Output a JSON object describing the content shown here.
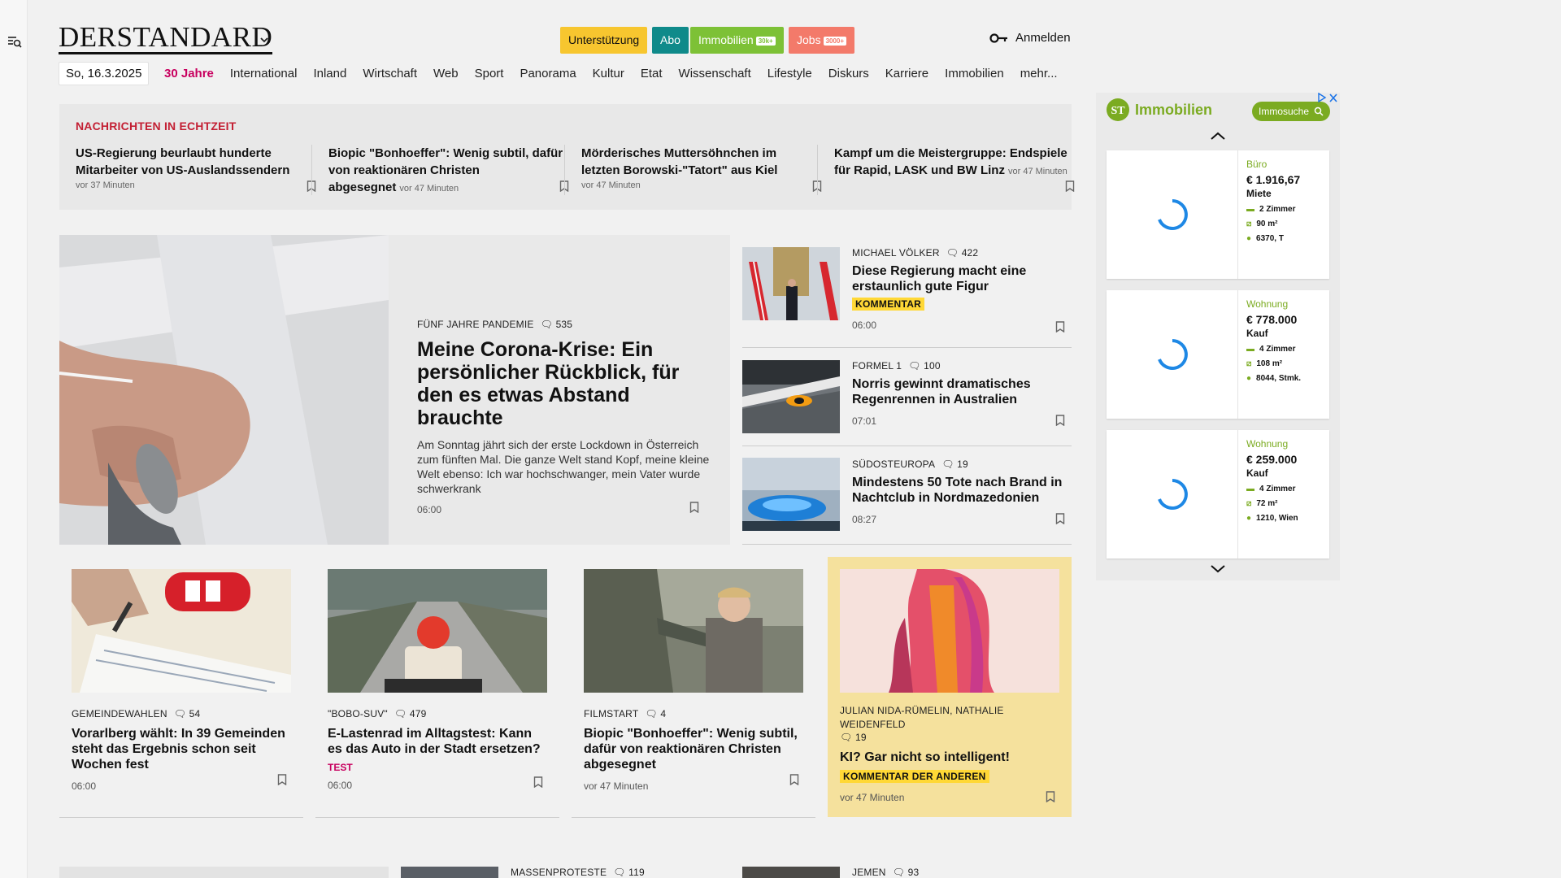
{
  "header": {
    "logo": "DERSTANDARD",
    "pills": {
      "unterstuetzung": "Unterstützung",
      "abo": "Abo",
      "immobilien": "Immobilien",
      "immobilien_tag": "30k+",
      "jobs": "Jobs",
      "jobs_tag": "3000+"
    },
    "login": "Anmelden",
    "date": "So, 16.3.2025"
  },
  "nav": [
    "30 Jahre",
    "International",
    "Inland",
    "Wirtschaft",
    "Web",
    "Sport",
    "Panorama",
    "Kultur",
    "Etat",
    "Wissenschaft",
    "Lifestyle",
    "Diskurs",
    "Karriere",
    "Immobilien",
    "mehr..."
  ],
  "ticker": {
    "heading": "NACHRICHTEN IN ECHTZEIT",
    "items": [
      {
        "title": "US-Regierung beurlaubt hunderte Mitarbeiter von US-Auslandssendern",
        "ago": "vor 37 Minuten"
      },
      {
        "title": "Biopic \"Bonhoeffer\": Wenig subtil, dafür von reaktionären Christen abgesegnet",
        "ago": "vor 47 Minuten"
      },
      {
        "title": "Mörderisches Muttersöhnchen im letzten Borowski-\"Tatort\" aus Kiel",
        "ago": "vor 47 Minuten"
      },
      {
        "title": "Kampf um die Meistergruppe: Endspiele für Rapid, LASK und BW Linz",
        "ago": "vor 47 Minuten"
      }
    ]
  },
  "lead": {
    "kicker": "FÜNF JAHRE PANDEMIE",
    "comments": "535",
    "title": "Meine Corona-Krise: Ein persönlicher Rückblick, für den es etwas Abstand brauchte",
    "teaser": "Am Sonntag jährt sich der erste Lockdown in Österreich zum fünften Mal. Die ganze Welt stand Kopf, meine kleine Welt ebenso: Ich war hochschwanger, mein Vater wurde schwerkrank",
    "time": "06:00"
  },
  "right_stories": [
    {
      "kicker": "MICHAEL VÖLKER",
      "comments": "422",
      "title": "Diese Regierung macht eine erstaunlich gute Figur",
      "badge": "KOMMENTAR",
      "time": "06:00"
    },
    {
      "kicker": "FORMEL 1",
      "comments": "100",
      "title": "Norris gewinnt dramatisches Regenrennen in Australien",
      "time": "07:01"
    },
    {
      "kicker": "SÜDOSTEUROPA",
      "comments": "19",
      "title": "Mindestens 50 Tote nach Brand in Nachtclub in Nordmazedonien",
      "time": "08:27"
    }
  ],
  "cards": [
    {
      "kicker": "GEMEINDEWAHLEN",
      "comments": "54",
      "title": "Vorarlberg wählt: In 39 Gemeinden steht das Ergebnis schon seit Wochen fest",
      "time": "06:00"
    },
    {
      "kicker": "\"BOBO-SUV\"",
      "comments": "479",
      "title": "E-Lastenrad im Alltagstest: Kann es das Auto in der Stadt ersetzen?",
      "label": "TEST",
      "time": "06:00"
    },
    {
      "kicker": "FILMSTART",
      "comments": "4",
      "title": "Biopic \"Bonhoeffer\": Wenig subtil, dafür von reaktionären Christen abgesegnet",
      "time": "vor 47 Minuten"
    },
    {
      "kicker": "JULIAN NIDA-RÜMELIN, NATHALIE WEIDENFELD",
      "comments": "19",
      "title": "KI? Gar nicht so intelligent!",
      "badge": "KOMMENTAR DER ANDEREN",
      "time": "vor 47 Minuten"
    }
  ],
  "bottom": [
    {
      "kicker": "MASSENPROTESTE",
      "comments": "119"
    },
    {
      "kicker": "JEMEN",
      "comments": "93"
    }
  ],
  "ad": {
    "brand": "Immobilien",
    "search_button": "Immosuche",
    "listings": [
      {
        "category": "Büro",
        "price": "€ 1.916,67",
        "kind": "Miete",
        "rooms": "2 Zimmer",
        "area": "90 m²",
        "location": "6370, T"
      },
      {
        "category": "Wohnung",
        "price": "€ 778.000",
        "kind": "Kauf",
        "rooms": "4 Zimmer",
        "area": "108 m²",
        "location": "8044, Stmk."
      },
      {
        "category": "Wohnung",
        "price": "€ 259.000",
        "kind": "Kauf",
        "rooms": "4 Zimmer",
        "area": "72 m²",
        "location": "1210, Wien"
      }
    ]
  },
  "colors": {
    "accent_red": "#c31f33",
    "pink": "#c8005f",
    "badge_yellow": "#ffd836",
    "pill_support": "#f7c62f",
    "pill_abo": "#0f8a8a",
    "pill_immo": "#7dc136",
    "pill_jobs": "#f37a6a",
    "immo_green": "#7bab21"
  }
}
